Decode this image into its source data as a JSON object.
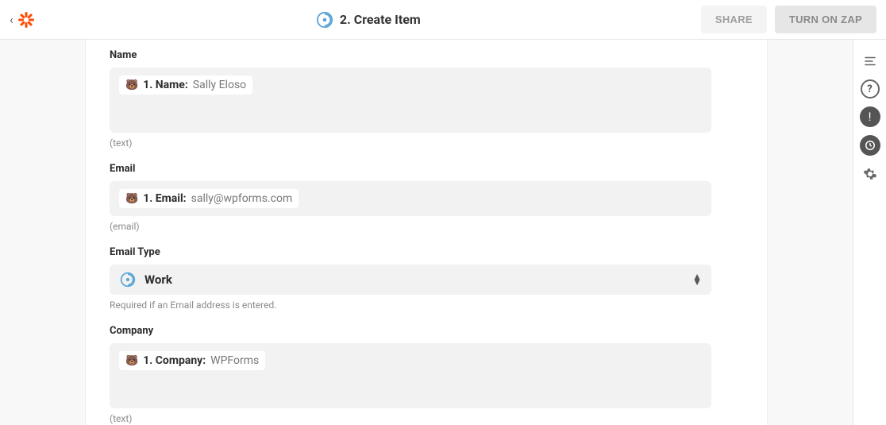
{
  "header": {
    "title": "2. Create Item",
    "share_label": "SHARE",
    "turn_on_label": "TURN ON ZAP"
  },
  "fields": {
    "name": {
      "label": "Name",
      "chip_label": "1. Name:",
      "chip_value": "Sally Eloso",
      "hint": "(text)"
    },
    "email": {
      "label": "Email",
      "chip_label": "1. Email:",
      "chip_value": "sally@wpforms.com",
      "hint": "(email)"
    },
    "email_type": {
      "label": "Email Type",
      "selected": "Work",
      "hint": "Required if an Email address is entered."
    },
    "company": {
      "label": "Company",
      "chip_label": "1. Company:",
      "chip_value": "WPForms",
      "hint": "(text)"
    }
  }
}
